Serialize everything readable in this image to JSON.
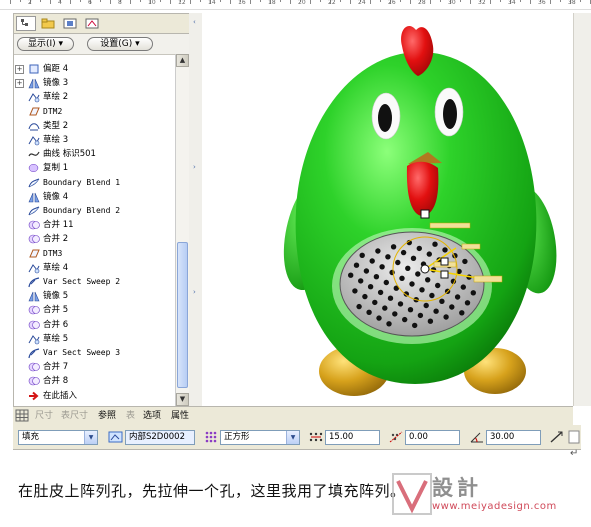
{
  "ruler": {
    "numbers": [
      "2",
      "4",
      "6",
      "8",
      "10",
      "12",
      "14",
      "16",
      "18",
      "20",
      "22",
      "24",
      "26",
      "28",
      "30",
      "32",
      "34",
      "36",
      "38"
    ]
  },
  "colors": {
    "body_green": "#2ed22a",
    "comb_red": "#e21010",
    "feet_gold": "#d7a21c",
    "patch_gray": "#c8c8c8",
    "hole_black": "#111111",
    "panel_bg": "#f2f1ec"
  },
  "navigator": {
    "tabs": [
      {
        "icon": "model-tree-icon",
        "active": true
      },
      {
        "icon": "folder-browser-icon",
        "active": false
      },
      {
        "icon": "favorites-icon",
        "active": false
      },
      {
        "icon": "connections-icon",
        "active": false
      }
    ],
    "show_button": "显示(I)",
    "settings_button": "设置(G)"
  },
  "tree": {
    "items": [
      {
        "icon": "offset-icon",
        "label": "偏距 4",
        "expander": "+"
      },
      {
        "icon": "mirror-icon",
        "label": "镜像 3",
        "expander": "+"
      },
      {
        "icon": "sketch-icon",
        "label": "草绘 2",
        "expander": ""
      },
      {
        "icon": "datum-plane-icon",
        "label": "DTM2",
        "expander": ""
      },
      {
        "icon": "style-icon",
        "label": "类型 2",
        "expander": ""
      },
      {
        "icon": "sketch-icon",
        "label": "草绘 3",
        "expander": ""
      },
      {
        "icon": "curve-icon",
        "label": "曲线 标识501",
        "expander": ""
      },
      {
        "icon": "copy-icon",
        "label": "复制 1",
        "expander": ""
      },
      {
        "icon": "boundary-blend-icon",
        "label": "Boundary Blend 1",
        "expander": ""
      },
      {
        "icon": "mirror-icon",
        "label": "镜像 4",
        "expander": ""
      },
      {
        "icon": "boundary-blend-icon",
        "label": "Boundary Blend 2",
        "expander": ""
      },
      {
        "icon": "merge-icon",
        "label": "合并 11",
        "expander": ""
      },
      {
        "icon": "merge-icon",
        "label": "合并 2",
        "expander": ""
      },
      {
        "icon": "datum-plane-icon",
        "label": "DTM3",
        "expander": ""
      },
      {
        "icon": "sketch-icon",
        "label": "草绘 4",
        "expander": ""
      },
      {
        "icon": "sweep-icon",
        "label": "Var Sect Sweep 2",
        "expander": ""
      },
      {
        "icon": "mirror-icon",
        "label": "镜像 5",
        "expander": ""
      },
      {
        "icon": "merge-icon",
        "label": "合并 5",
        "expander": ""
      },
      {
        "icon": "merge-icon",
        "label": "合并 6",
        "expander": ""
      },
      {
        "icon": "sketch-icon",
        "label": "草绘 5",
        "expander": ""
      },
      {
        "icon": "sweep-icon",
        "label": "Var Sect Sweep 3",
        "expander": ""
      },
      {
        "icon": "merge-icon",
        "label": "合并 7",
        "expander": ""
      },
      {
        "icon": "merge-icon",
        "label": "合并 8",
        "expander": ""
      },
      {
        "icon": "insert-here-icon",
        "label": "在此插入",
        "expander": ""
      }
    ]
  },
  "dashboard": {
    "tabs": [
      {
        "label": "尺寸",
        "enabled": false
      },
      {
        "label": "表尺寸",
        "enabled": false
      },
      {
        "label": "参照",
        "enabled": true
      },
      {
        "label": "表",
        "enabled": false
      },
      {
        "label": "选项",
        "enabled": true
      },
      {
        "label": "属性",
        "enabled": true
      }
    ],
    "pattern_type": "填充",
    "reference": "内部S2D0002",
    "grid_type": "正方形",
    "spacing": "15.00",
    "border_offset": "0.00",
    "rotation": "30.00"
  },
  "caption": "在肚皮上阵列孔，先拉伸一个孔，这里我用了填充阵列。",
  "watermark": {
    "title": "設計",
    "url": "www.meiyadesign.com"
  }
}
